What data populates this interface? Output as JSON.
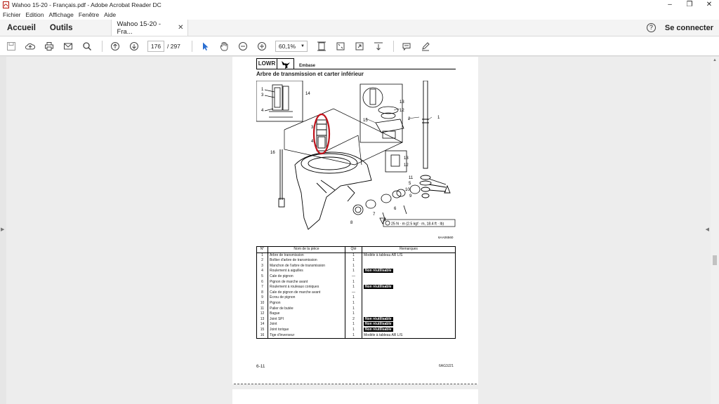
{
  "window": {
    "title": "Wahoo 15-20 - Français.pdf - Adobe Acrobat Reader DC"
  },
  "menu": {
    "items": [
      "Fichier",
      "Edition",
      "Affichage",
      "Fenêtre",
      "Aide"
    ]
  },
  "tabs": {
    "home": "Accueil",
    "tools": "Outils",
    "document": "Wahoo 15-20 - Fra...",
    "signin": "Se connecter"
  },
  "toolbar": {
    "page_current": "176",
    "page_total": "/ 297",
    "zoom": "60,1%"
  },
  "page": {
    "section_code": "LOWR",
    "section_name": "Embase",
    "title": "Arbre de transmission et carter inférieur",
    "torque_note": "25 N · m (2.5 kgf · m, 18.4 ft · lb)",
    "figure_code": "6AA06560",
    "callouts": [
      "1",
      "2",
      "3",
      "4",
      "5",
      "6",
      "7",
      "8",
      "9",
      "10",
      "11",
      "12",
      "13",
      "14",
      "15",
      "16"
    ],
    "table": {
      "headers": [
        "N°",
        "Nom de la pièce",
        "Qté",
        "Remarques"
      ],
      "rows": [
        {
          "num": "1",
          "name": "Arbre de transmission",
          "qty": "1",
          "remark": "Modèle à tableau AR L/S",
          "badge": false
        },
        {
          "num": "2",
          "name": "Boîtier d'arbre de transmission",
          "qty": "1",
          "remark": "",
          "badge": false
        },
        {
          "num": "3",
          "name": "Manchon de l'arbre de transmission",
          "qty": "1",
          "remark": "",
          "badge": false
        },
        {
          "num": "4",
          "name": "Roulement à aiguilles",
          "qty": "1",
          "remark": "Non réutilisable",
          "badge": true
        },
        {
          "num": "5",
          "name": "Cale de pignon",
          "qty": "—",
          "remark": "",
          "badge": false
        },
        {
          "num": "6",
          "name": "Pignon de marche avant",
          "qty": "1",
          "remark": "",
          "badge": false
        },
        {
          "num": "7",
          "name": "Roulement à rouleaux coniques",
          "qty": "1",
          "remark": "Non réutilisable",
          "badge": true
        },
        {
          "num": "8",
          "name": "Cale de pignon de marche avant",
          "qty": "—",
          "remark": "",
          "badge": false
        },
        {
          "num": "9",
          "name": "Écrou de pignon",
          "qty": "1",
          "remark": "",
          "badge": false
        },
        {
          "num": "10",
          "name": "Pignon",
          "qty": "1",
          "remark": "",
          "badge": false
        },
        {
          "num": "11",
          "name": "Palier de butée",
          "qty": "1",
          "remark": "",
          "badge": false
        },
        {
          "num": "12",
          "name": "Bague",
          "qty": "1",
          "remark": "",
          "badge": false
        },
        {
          "num": "13",
          "name": "Joint SPI",
          "qty": "2",
          "remark": "Non réutilisable",
          "badge": true
        },
        {
          "num": "14",
          "name": "Joint",
          "qty": "1",
          "remark": "Non réutilisable",
          "badge": true
        },
        {
          "num": "15",
          "name": "Joint torique",
          "qty": "1",
          "remark": "Non réutilisable",
          "badge": true
        },
        {
          "num": "16",
          "name": "Tige d'inverseur",
          "qty": "1",
          "remark": "Modèle à tableau AR L/S",
          "badge": false
        }
      ]
    },
    "footer_left": "6-11",
    "footer_right": "6AG3J21"
  }
}
